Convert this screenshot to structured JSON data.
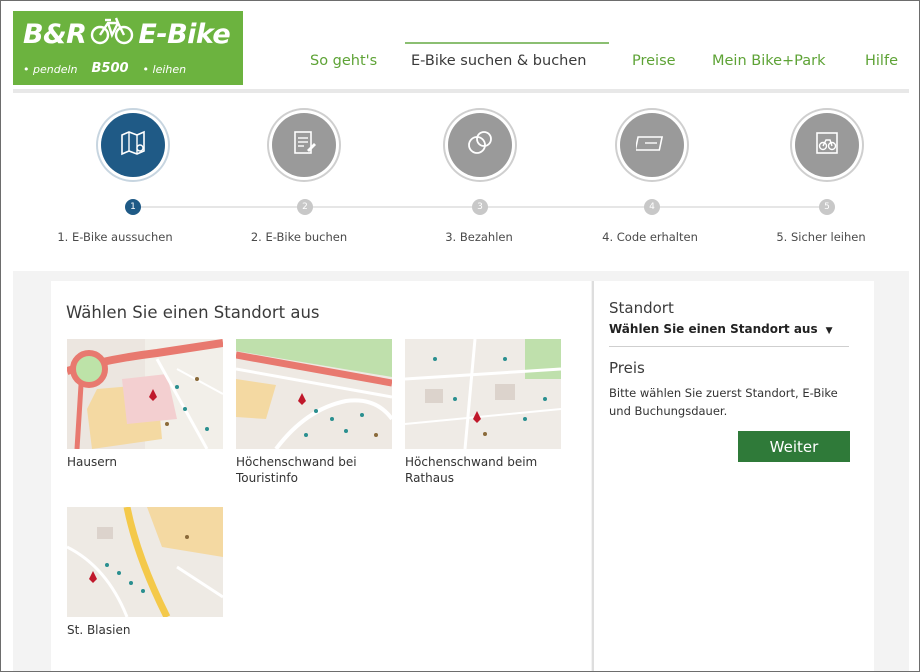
{
  "logo": {
    "title_left": "B&R",
    "title_right": "E-Bike",
    "sub_left": "• pendeln",
    "sub_mid": "B500",
    "sub_right": "• leihen"
  },
  "nav": {
    "items": [
      {
        "label": "So geht's",
        "active": false
      },
      {
        "label": "E-Bike suchen & buchen",
        "active": true
      },
      {
        "label": "Preise",
        "active": false
      },
      {
        "label": "Mein Bike+Park",
        "active": false
      },
      {
        "label": "Hilfe",
        "active": false
      }
    ]
  },
  "steps": [
    {
      "number": "1",
      "label": "1. E-Bike aussuchen",
      "icon": "map-icon",
      "active": true
    },
    {
      "number": "2",
      "label": "2. E-Bike buchen",
      "icon": "booking-icon",
      "active": false
    },
    {
      "number": "3",
      "label": "3. Bezahlen",
      "icon": "payment-icon",
      "active": false
    },
    {
      "number": "4",
      "label": "4. Code erhalten",
      "icon": "code-card-icon",
      "active": false
    },
    {
      "number": "5",
      "label": "5. Sicher leihen",
      "icon": "bike-lock-icon",
      "active": false
    }
  ],
  "locations": {
    "title": "Wählen Sie einen Standort aus",
    "items": [
      {
        "name": "Hausern"
      },
      {
        "name": "Höchenschwand bei Touristinfo"
      },
      {
        "name": "Höchenschwand beim Rathaus"
      },
      {
        "name": "St. Blasien"
      }
    ]
  },
  "sidebar": {
    "standort_heading": "Standort",
    "standort_select": "Wählen Sie einen Standort aus",
    "preis_heading": "Preis",
    "preis_text": "Bitte wählen Sie zuerst Standort, E-Bike und Buchungsdauer.",
    "weiter_label": "Weiter"
  },
  "colors": {
    "brand_green": "#6cb33f",
    "nav_green": "#5ea336",
    "active_step": "#1f5a86",
    "button_green": "#2f7a39"
  }
}
